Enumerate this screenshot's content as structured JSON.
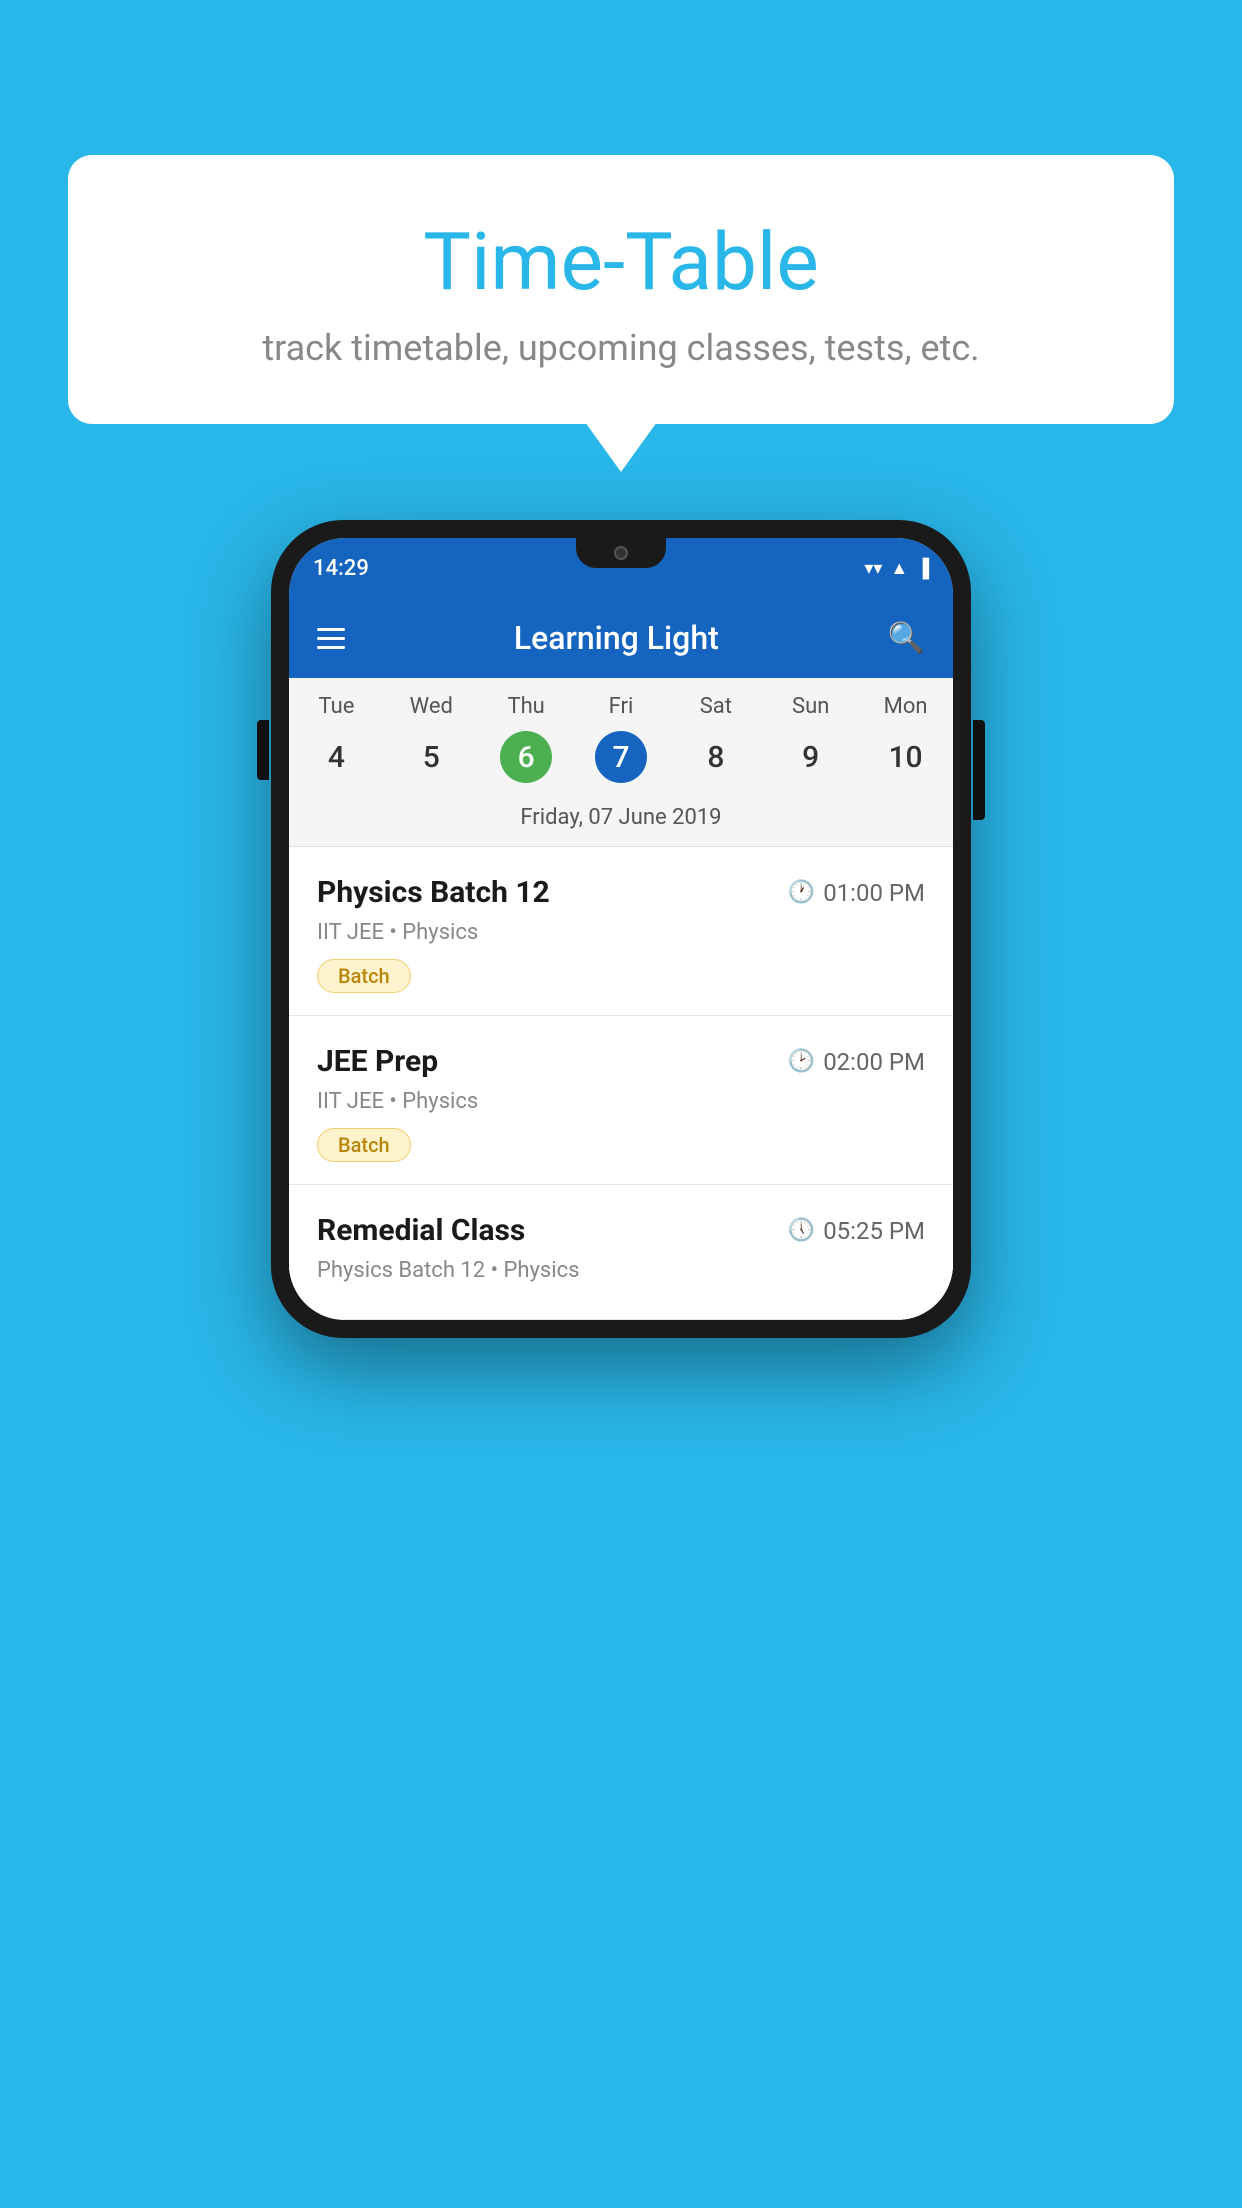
{
  "background_color": "#29B6E8",
  "speech_bubble": {
    "title": "Time-Table",
    "subtitle": "track timetable, upcoming classes, tests, etc."
  },
  "phone": {
    "status_bar": {
      "time": "14:29",
      "wifi": "▼",
      "signal": "▲",
      "battery": "▌"
    },
    "app_bar": {
      "title": "Learning Light",
      "menu_label": "menu",
      "search_label": "search"
    },
    "calendar": {
      "days": [
        "Tue",
        "Wed",
        "Thu",
        "Fri",
        "Sat",
        "Sun",
        "Mon"
      ],
      "dates": [
        "4",
        "5",
        "6",
        "7",
        "8",
        "9",
        "10"
      ],
      "today_index": 2,
      "selected_index": 3,
      "selected_label": "Friday, 07 June 2019"
    },
    "schedule_items": [
      {
        "name": "Physics Batch 12",
        "time": "01:00 PM",
        "meta": "IIT JEE • Physics",
        "tag": "Batch"
      },
      {
        "name": "JEE Prep",
        "time": "02:00 PM",
        "meta": "IIT JEE • Physics",
        "tag": "Batch"
      },
      {
        "name": "Remedial Class",
        "time": "05:25 PM",
        "meta": "Physics Batch 12 • Physics",
        "tag": ""
      }
    ]
  }
}
